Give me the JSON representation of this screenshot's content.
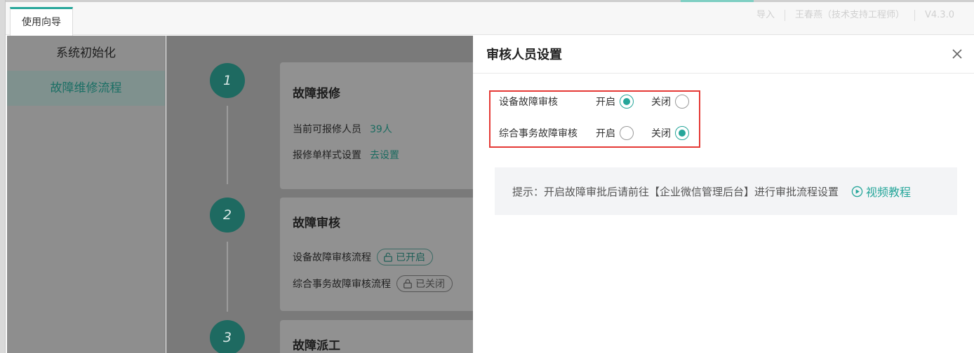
{
  "header": {
    "tab_label": "使用向导",
    "import_label": "导入",
    "user_label": "王春燕（技术支持工程师）",
    "version": "V4.3.0"
  },
  "sidebar": {
    "items": [
      {
        "label": "系统初始化",
        "active": false
      },
      {
        "label": "故障维修流程",
        "active": true
      }
    ]
  },
  "steps": [
    {
      "number": "1",
      "title": "故障报修",
      "rows": [
        {
          "label": "当前可报修人员",
          "value": "39人"
        },
        {
          "label": "报修单样式设置",
          "value": "去设置"
        }
      ]
    },
    {
      "number": "2",
      "title": "故障审核",
      "rows": [
        {
          "label": "设备故障审核流程",
          "status": "已开启"
        },
        {
          "label": "综合事务故障审核流程",
          "status": "已关闭"
        }
      ]
    },
    {
      "number": "3",
      "title": "故障派工"
    }
  ],
  "panel": {
    "title": "审核人员设置",
    "options": [
      {
        "label": "设备故障审核",
        "on_label": "开启",
        "off_label": "关闭",
        "selected": "on"
      },
      {
        "label": "综合事务故障审核",
        "on_label": "开启",
        "off_label": "关闭",
        "selected": "off"
      }
    ],
    "tip": "提示：开启故障审批后请前往【企业微信管理后台】进行审批流程设置",
    "tip_link": "视频教程"
  },
  "colors": {
    "accent": "#26a69a",
    "highlight_border": "#e53935"
  }
}
